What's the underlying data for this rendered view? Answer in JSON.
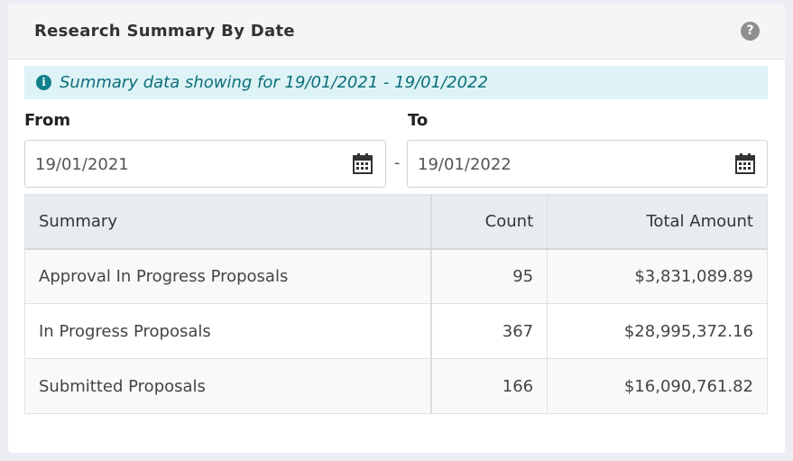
{
  "header": {
    "title": "Research Summary By Date",
    "help_icon": "question-circle-icon"
  },
  "alert": {
    "icon": "info-circle-icon",
    "text": "Summary data showing for 19/01/2021 - 19/01/2022",
    "color": "#0b6e79",
    "background": "#def3f6"
  },
  "filters": {
    "from_label": "From",
    "to_label": "To",
    "from_value": "19/01/2021",
    "to_value": "19/01/2022",
    "separator": "-",
    "calendar_icon": "calendar-icon"
  },
  "table": {
    "headers": [
      "Summary",
      "Count",
      "Total Amount"
    ],
    "rows": [
      {
        "summary": "Approval In Progress Proposals",
        "count": "95",
        "amount": "$3,831,089.89"
      },
      {
        "summary": "In Progress Proposals",
        "count": "367",
        "amount": "$28,995,372.16"
      },
      {
        "summary": "Submitted Proposals",
        "count": "166",
        "amount": "$16,090,761.82"
      }
    ]
  }
}
